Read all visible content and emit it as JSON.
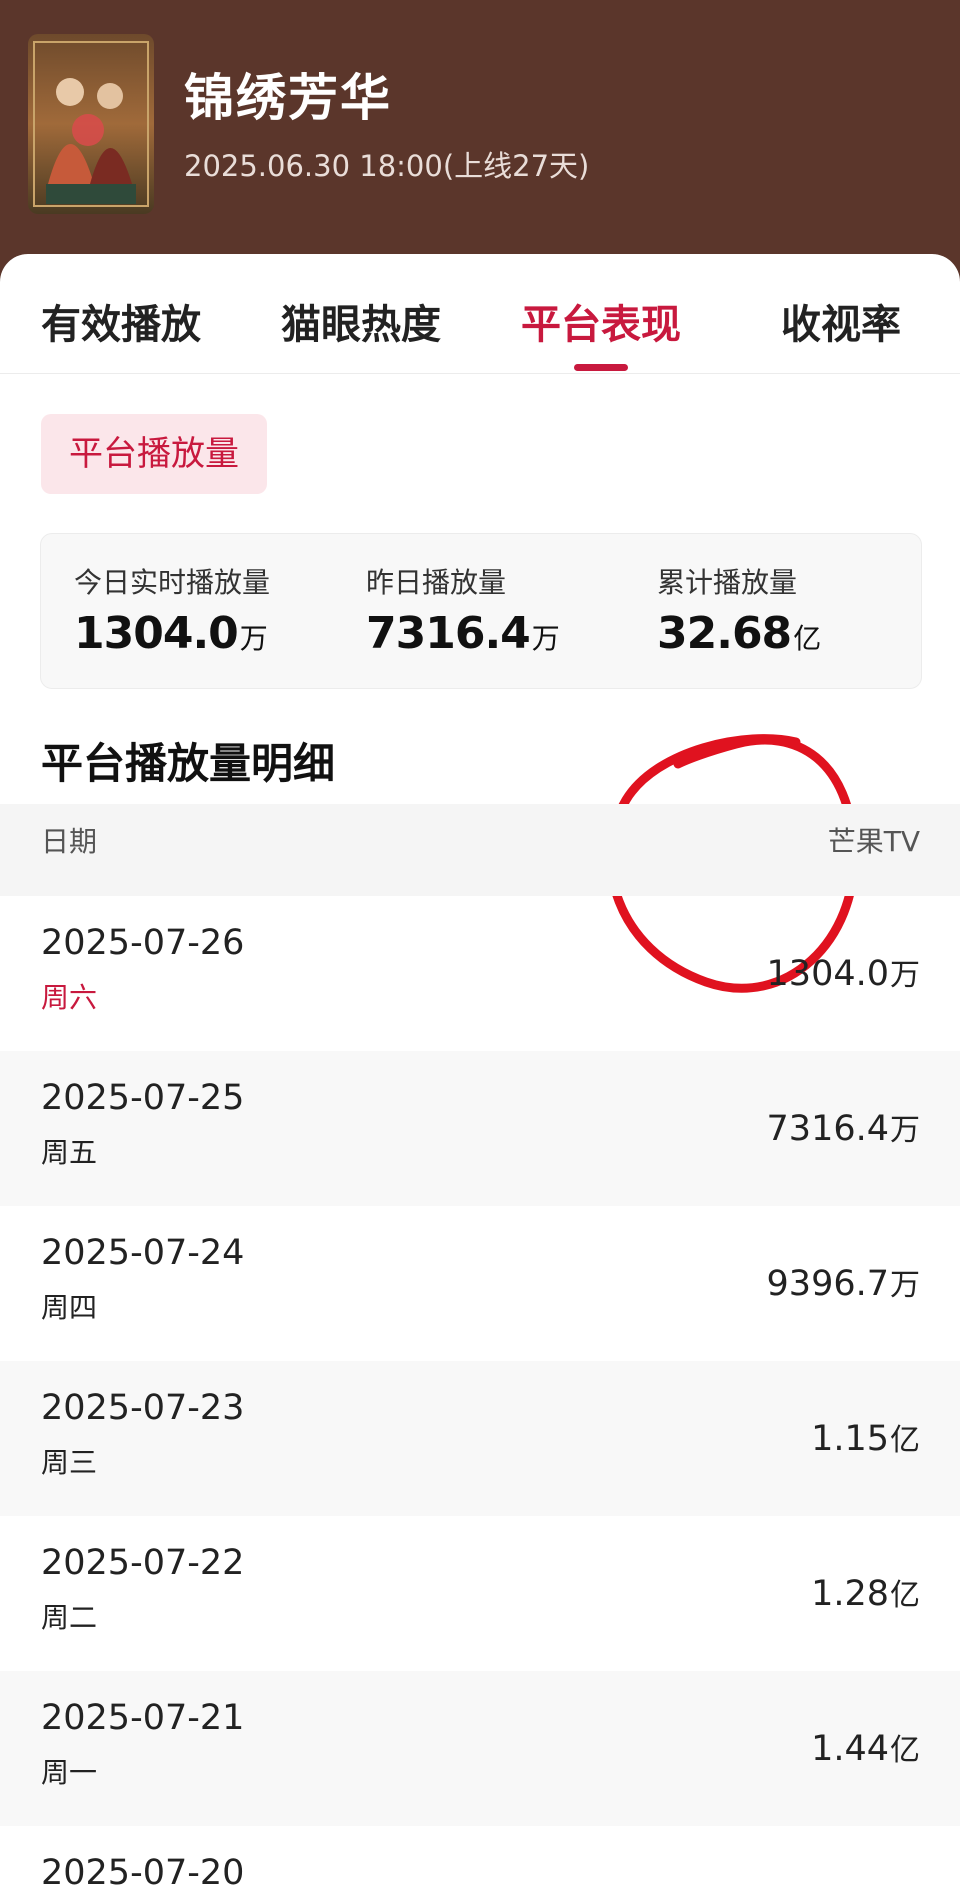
{
  "header": {
    "title": "锦绣芳华",
    "subtitle": "2025.06.30 18:00(上线27天)",
    "poster_text": "锦绣芳华"
  },
  "tabs": [
    {
      "label": "有效播放",
      "active": false
    },
    {
      "label": "猫眼热度",
      "active": false
    },
    {
      "label": "平台表现",
      "active": true
    },
    {
      "label": "收视率",
      "active": false
    }
  ],
  "filter_chip": "平台播放量",
  "stats": [
    {
      "label": "今日实时播放量",
      "value": "1304.0",
      "unit": "万"
    },
    {
      "label": "昨日播放量",
      "value": "7316.4",
      "unit": "万"
    },
    {
      "label": "累计播放量",
      "value": "32.68",
      "unit": "亿"
    }
  ],
  "annotation": {
    "circle_color": "#e0121f"
  },
  "section_title": "平台播放量明细",
  "table": {
    "columns": [
      "日期",
      "芒果TV"
    ],
    "rows": [
      {
        "date": "2025-07-26",
        "weekday": "周六",
        "value": "1304.0",
        "unit": "万",
        "highlight": true
      },
      {
        "date": "2025-07-25",
        "weekday": "周五",
        "value": "7316.4",
        "unit": "万"
      },
      {
        "date": "2025-07-24",
        "weekday": "周四",
        "value": "9396.7",
        "unit": "万"
      },
      {
        "date": "2025-07-23",
        "weekday": "周三",
        "value": "1.15",
        "unit": "亿"
      },
      {
        "date": "2025-07-22",
        "weekday": "周二",
        "value": "1.28",
        "unit": "亿"
      },
      {
        "date": "2025-07-21",
        "weekday": "周一",
        "value": "1.44",
        "unit": "亿"
      },
      {
        "date": "2025-07-20",
        "weekday": "",
        "value": "",
        "unit": ""
      }
    ]
  },
  "colors": {
    "header_bg": "#5b362b",
    "accent": "#c8193e",
    "chip_bg": "#fbe6ea"
  }
}
